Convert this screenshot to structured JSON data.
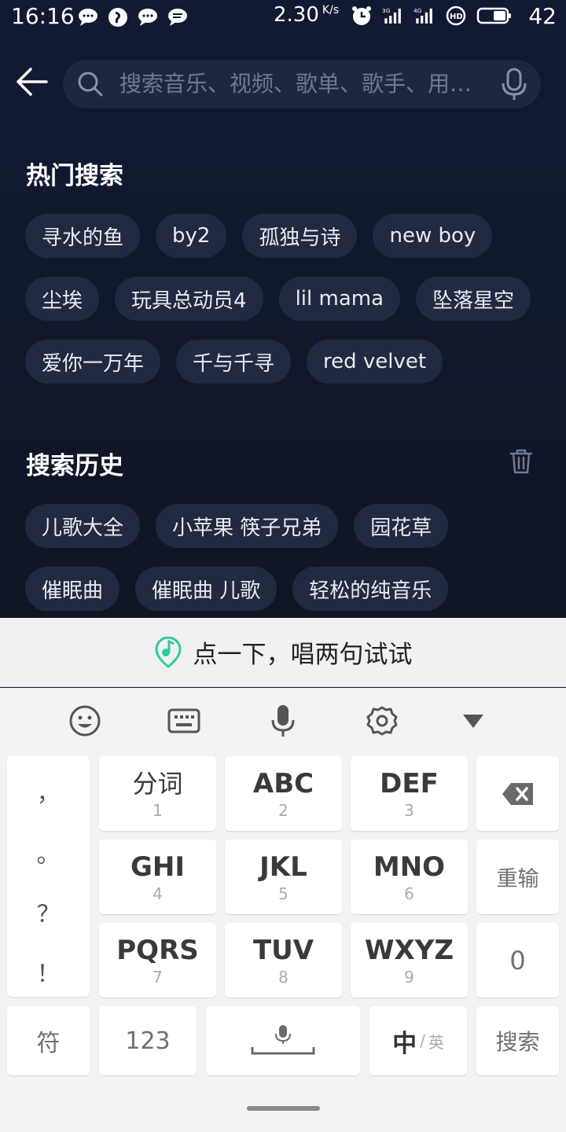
{
  "status_bar": {
    "time": "16:16",
    "speed_value": "2.30",
    "speed_unit": "K/s",
    "battery": "42",
    "network_labels": [
      "3G",
      "4G",
      "HD"
    ]
  },
  "search": {
    "placeholder": "搜索音乐、视频、歌单、歌手、用…"
  },
  "hot_search": {
    "title": "热门搜索",
    "rows": [
      [
        "寻水的鱼",
        "by2",
        "孤独与诗",
        "new boy"
      ],
      [
        "尘埃",
        "玩具总动员4",
        "lil mama",
        "坠落星空"
      ],
      [
        "爱你一万年",
        "千与千寻",
        "red velvet"
      ]
    ]
  },
  "history": {
    "title": "搜索历史",
    "rows": [
      [
        "儿歌大全",
        "小苹果 筷子兄弟",
        "园花草"
      ],
      [
        "催眠曲",
        "催眠曲 儿歌",
        "轻松的纯音乐"
      ]
    ]
  },
  "keyboard": {
    "sing_prompt": "点一下，唱两句试试",
    "punctuation": [
      "，",
      "。",
      "？",
      "！"
    ],
    "keys": {
      "k1": {
        "main": "分词",
        "sub": "1"
      },
      "k2": {
        "main": "ABC",
        "sub": "2"
      },
      "k3": {
        "main": "DEF",
        "sub": "3"
      },
      "k4": {
        "main": "GHI",
        "sub": "4"
      },
      "k5": {
        "main": "JKL",
        "sub": "5"
      },
      "k6": {
        "main": "MNO",
        "sub": "6"
      },
      "k7": {
        "main": "PQRS",
        "sub": "7"
      },
      "k8": {
        "main": "TUV",
        "sub": "8"
      },
      "k9": {
        "main": "WXYZ",
        "sub": "9"
      }
    },
    "retype": "重输",
    "zero": "0",
    "symbols": "符",
    "numbers": "123",
    "lang_main": "中",
    "lang_sep": "/",
    "lang_alt": "英",
    "search_key": "搜索"
  },
  "colors": {
    "background": "#10182b",
    "chip": "#222a41",
    "accent_green": "#2ecc9a"
  }
}
